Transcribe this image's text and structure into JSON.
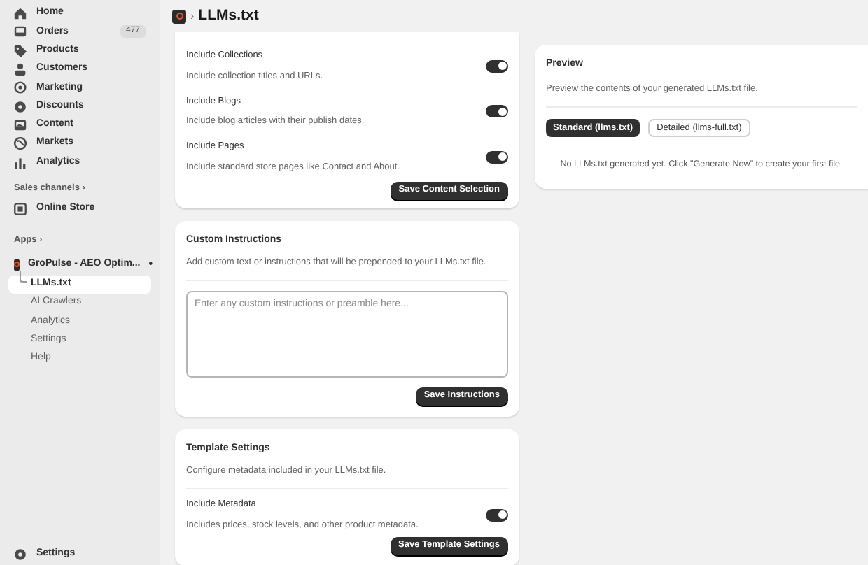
{
  "sidebar": {
    "items": [
      {
        "label": "Home"
      },
      {
        "label": "Orders",
        "badge": "477"
      },
      {
        "label": "Products"
      },
      {
        "label": "Customers"
      },
      {
        "label": "Marketing"
      },
      {
        "label": "Discounts"
      },
      {
        "label": "Content"
      },
      {
        "label": "Markets"
      },
      {
        "label": "Analytics"
      }
    ],
    "sales_channels": {
      "heading": "Sales channels ›",
      "items": [
        {
          "label": "Online Store"
        }
      ]
    },
    "apps": {
      "heading": "Apps ›",
      "app": {
        "label": "GroPulse - AEO Optim...",
        "marker": "•",
        "children": [
          {
            "label": "LLMs.txt",
            "selected": true
          },
          {
            "label": "AI Crawlers",
            "selected": false
          },
          {
            "label": "Analytics",
            "selected": false
          },
          {
            "label": "Settings",
            "selected": false
          },
          {
            "label": "Help",
            "selected": false
          }
        ]
      }
    },
    "footer": {
      "label": "Settings"
    }
  },
  "header": {
    "separator": "›",
    "title": "LLMs.txt"
  },
  "content_card": {
    "options": [
      {
        "title": "Include Collections",
        "description": "Include collection titles and URLs.",
        "on": true
      },
      {
        "title": "Include Blogs",
        "description": "Include blog articles with their publish dates.",
        "on": true
      },
      {
        "title": "Include Pages",
        "description": "Include standard store pages like Contact and About.",
        "on": true
      }
    ],
    "button": "Save Content Selection"
  },
  "instructions_card": {
    "title": "Custom Instructions",
    "description": "Add custom text or instructions that will be prepended to your LLMs.txt file.",
    "placeholder": "Enter any custom instructions or preamble here...",
    "button": "Save Instructions"
  },
  "template_card": {
    "title": "Template Settings",
    "description": "Configure metadata included in your LLMs.txt file.",
    "options": [
      {
        "title": "Include Metadata",
        "description": "Includes prices, stock levels, and other product metadata.",
        "on": true
      }
    ],
    "button": "Save Template Settings"
  },
  "preview_card": {
    "title": "Preview",
    "description": "Preview the contents of your generated LLMs.txt file.",
    "tabs": [
      {
        "label": "Standard (llms.txt)",
        "selected": true
      },
      {
        "label": "Detailed (llms-full.txt)",
        "selected": false
      }
    ],
    "empty_message": "No LLMs.txt generated yet. Click \"Generate Now\" to create your first file."
  }
}
